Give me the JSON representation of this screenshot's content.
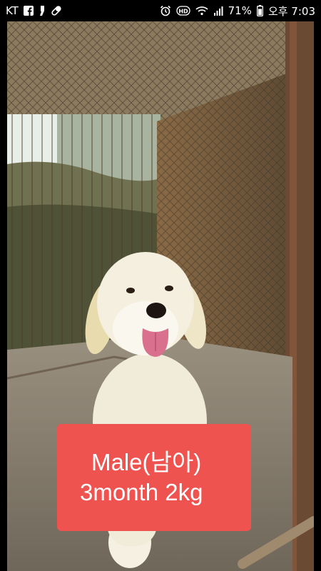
{
  "status_bar": {
    "carrier": "KT",
    "left_icons": [
      "facebook-icon",
      "messenger-icon",
      "pill-icon"
    ],
    "right_icons": [
      "alarm-icon",
      "hd-icon",
      "wifi-icon",
      "signal-icon"
    ],
    "battery_percent": "71%",
    "time": "오후 7:03",
    "colors": {
      "background": "#000000",
      "text": "#ffffff"
    }
  },
  "photo": {
    "subject": "puppy-in-cage"
  },
  "caption": {
    "line1": "Male(남아)",
    "line2": "3month 2kg",
    "background": "#ef5350",
    "text_color": "#ffffff"
  }
}
